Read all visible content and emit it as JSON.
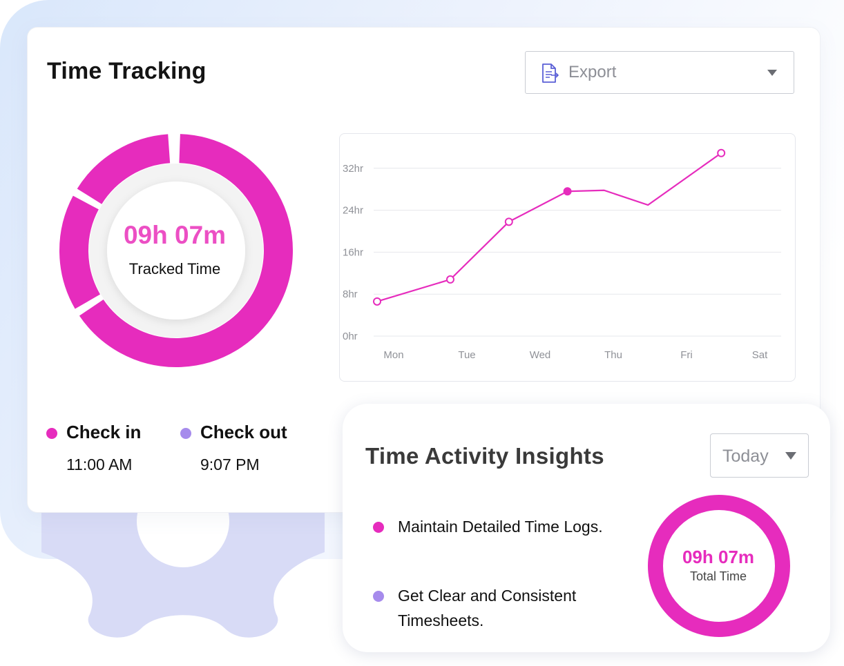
{
  "card": {
    "title": "Time Tracking",
    "export": {
      "label": "Export",
      "icon": "document-export-icon"
    },
    "tracked": {
      "time": "09h 07m",
      "label": "Tracked Time"
    },
    "check_in": {
      "label": "Check in",
      "time": "11:00 AM",
      "color": "#e62cbd"
    },
    "check_out": {
      "label": "Check out",
      "time": "9:07 PM",
      "color": "#a68bec"
    }
  },
  "chart_data": {
    "type": "line",
    "title": "",
    "xlabel": "",
    "ylabel": "",
    "categories": [
      "Mon",
      "Tue",
      "Wed",
      "Thu",
      "Fri",
      "Sat"
    ],
    "yticks": [
      "0hr",
      "8hr",
      "16hr",
      "24hr",
      "32hr"
    ],
    "ylim": [
      0,
      32
    ],
    "grid": true,
    "color": "#e62cbd",
    "points": [
      {
        "x": 0.0,
        "y": 6.6,
        "marker": "hollow"
      },
      {
        "x": 1.0,
        "y": 10.8,
        "marker": "hollow"
      },
      {
        "x": 1.8,
        "y": 21.8,
        "marker": "hollow"
      },
      {
        "x": 2.6,
        "y": 27.6,
        "marker": "filled"
      },
      {
        "x": 3.1,
        "y": 27.8,
        "marker": "none"
      },
      {
        "x": 3.7,
        "y": 25.0,
        "marker": "none"
      },
      {
        "x": 4.7,
        "y": 34.9,
        "marker": "hollow"
      }
    ]
  },
  "insights": {
    "title": "Time Activity Insights",
    "period": "Today",
    "items": [
      {
        "text": "Maintain Detailed Time Logs.",
        "color": "#e62cbd"
      },
      {
        "text": "Get Clear and Consistent Timesheets.",
        "color": "#a68bec"
      }
    ],
    "total": {
      "time": "09h 07m",
      "label": "Total Time"
    }
  },
  "colors": {
    "accent": "#e62cbd",
    "accent_light": "#ec4fc4",
    "purple": "#a68bec",
    "gear": "#d8dbf6"
  }
}
